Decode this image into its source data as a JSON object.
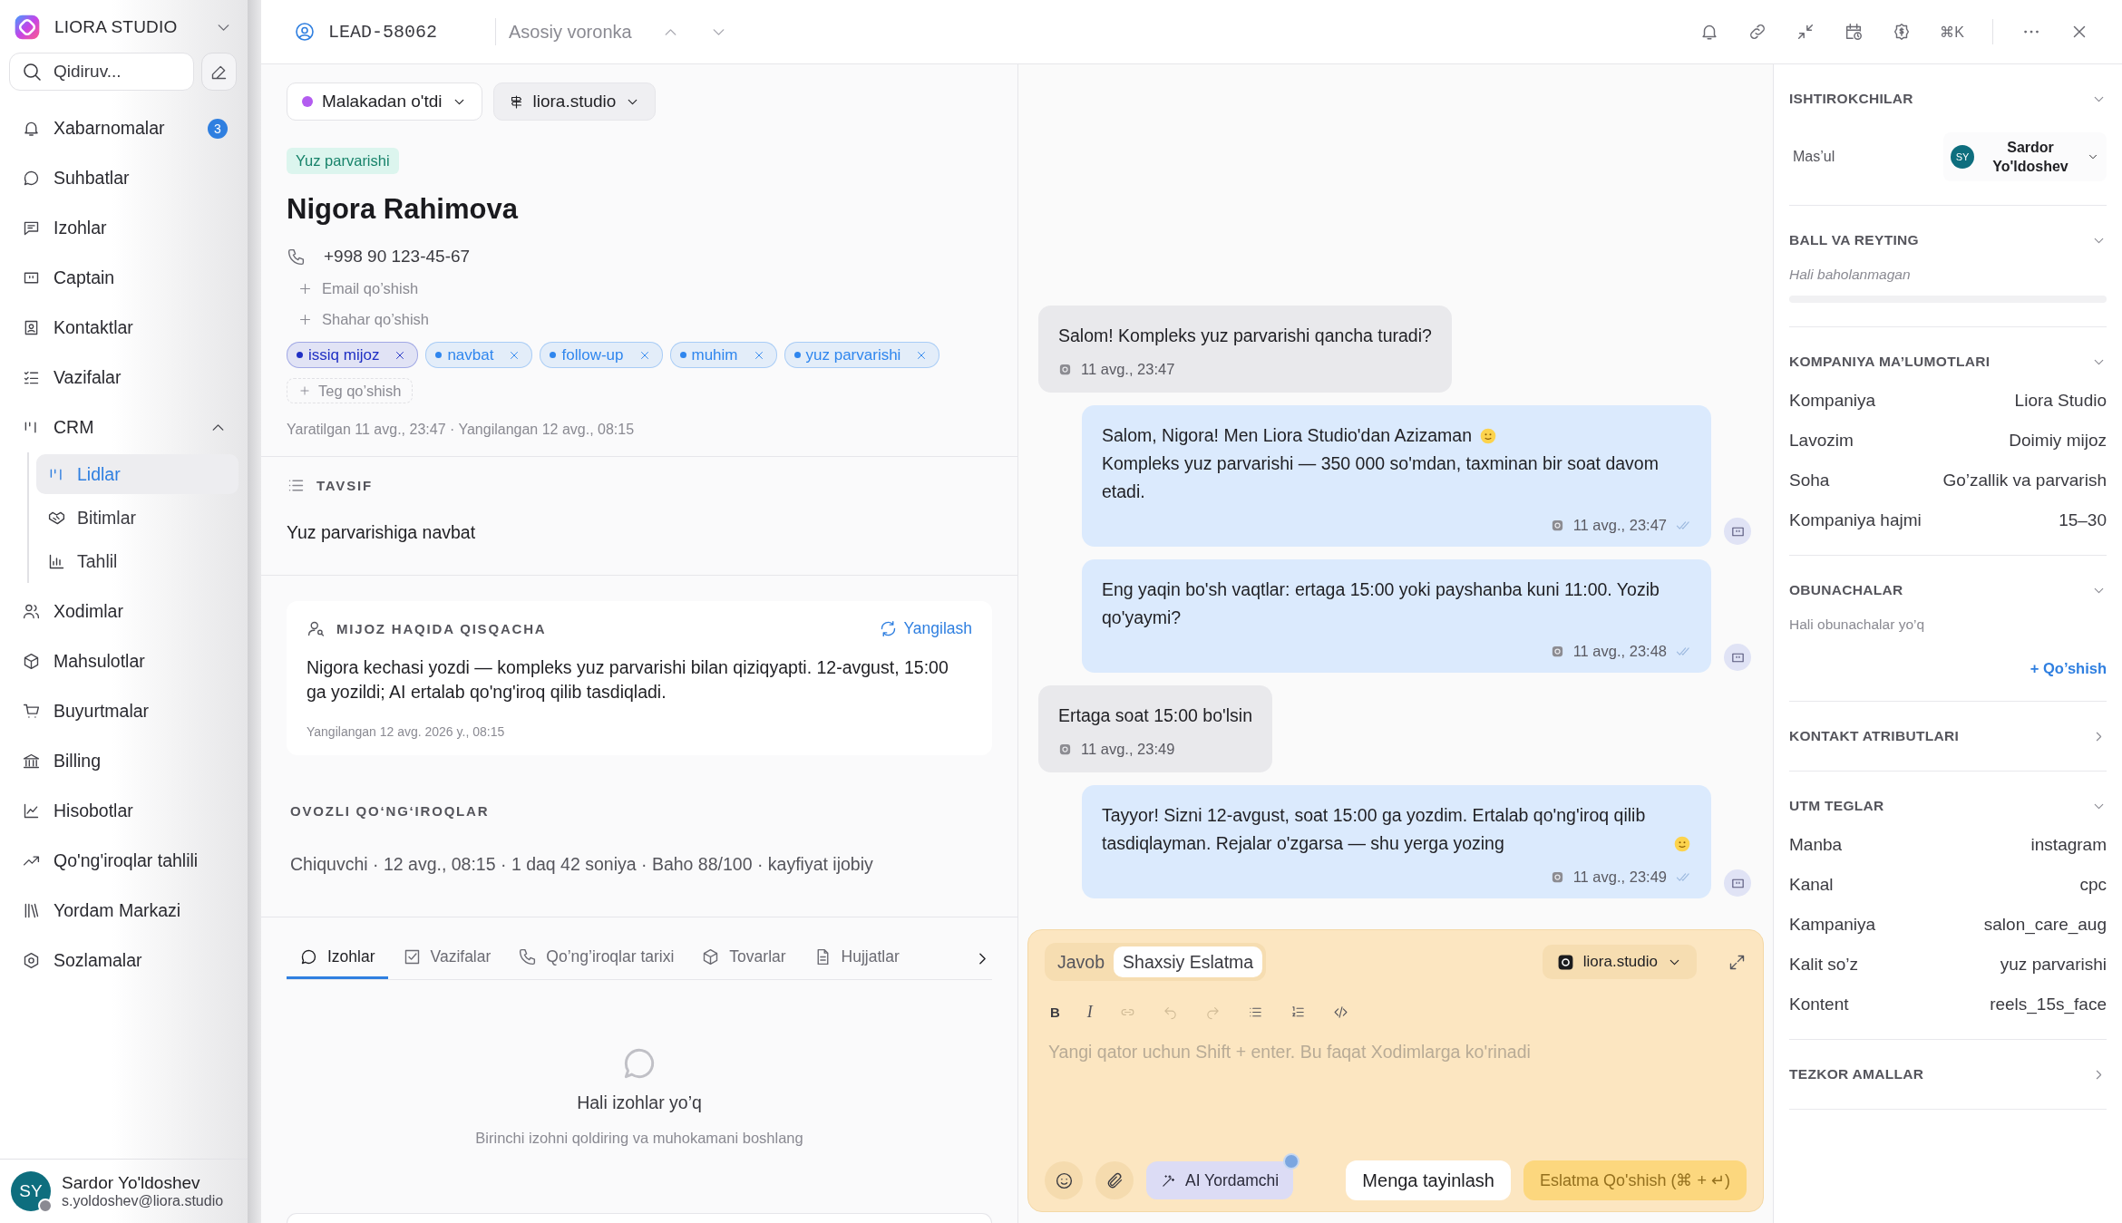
{
  "sidebar": {
    "workspace": "LIORA STUDIO",
    "search_placeholder": "Qidiruv...",
    "items": [
      {
        "label": "Xabarnomalar",
        "badge": "3",
        "selected": false
      },
      {
        "label": "Suhbatlar",
        "selected": false
      },
      {
        "label": "Izohlar",
        "selected": false
      },
      {
        "label": "Captain",
        "selected": false
      },
      {
        "label": "Kontaktlar",
        "selected": false
      },
      {
        "label": "Vazifalar",
        "selected": false
      },
      {
        "label": "CRM",
        "selected": false,
        "expanded": true,
        "children": [
          {
            "label": "Lidlar",
            "selected": true
          },
          {
            "label": "Bitimlar",
            "selected": false
          },
          {
            "label": "Tahlil",
            "selected": false
          }
        ]
      },
      {
        "label": "Xodimlar",
        "selected": false
      },
      {
        "label": "Mahsulotlar",
        "selected": false
      },
      {
        "label": "Buyurtmalar",
        "selected": false
      },
      {
        "label": "Billing",
        "selected": false
      },
      {
        "label": "Hisobotlar",
        "selected": false
      },
      {
        "label": "Qo'ng'iroqlar tahlili",
        "selected": false
      },
      {
        "label": "Yordam Markazi",
        "selected": false
      },
      {
        "label": "Sozlamalar",
        "selected": false
      }
    ],
    "user": {
      "initials": "SY",
      "name": "Sardor Yo'ldoshev",
      "email": "s.yoldoshev@liora.studio"
    }
  },
  "header": {
    "lead_id": "LEAD-58062",
    "pipeline": "Asosiy voronka",
    "shortcut": "⌘K"
  },
  "lead": {
    "status": {
      "label": "Malakadan o'tdi",
      "color": "#b35cf0"
    },
    "inbox": "liora.studio",
    "category": "Yuz parvarishi",
    "name": "Nigora Rahimova",
    "phone": "+998 90 123-45-67",
    "add_links": [
      "Email qo’shish",
      "Shahar qo’shish"
    ],
    "tags": [
      {
        "label": "issiq mijoz",
        "color": "#1f2fc4"
      },
      {
        "label": "navbat",
        "color": "#2f86ee"
      },
      {
        "label": "follow-up",
        "color": "#2f86ee"
      },
      {
        "label": "muhim",
        "color": "#2f86ee"
      },
      {
        "label": "yuz parvarishi",
        "color": "#2f86ee"
      }
    ],
    "add_tag": "Teg qo’shish",
    "meta": "Yaratilgan 11 avg., 23:47 · Yangilangan 12 avg., 08:15"
  },
  "description": {
    "title": "TAVSIF",
    "text": "Yuz parvarishiga navbat"
  },
  "summary": {
    "title": "MIJOZ HAQIDA QISQACHA",
    "refresh": "Yangilash",
    "text": "Nigora kechasi yozdi — kompleks yuz parvarishi bilan qiziqyapti. 12-avgust, 15:00 ga yozildi; AI ertalab qo'ng'iroq qilib tasdiqladi.",
    "updated": "Yangilangan 12 avg. 2026 y., 08:15"
  },
  "voice_calls": {
    "title": "OVOZLI QO‘NG‘IROQLAR",
    "entry": "Chiquvchi · 12 avg., 08:15 · 1 daq 42 soniya · Baho 88/100 · kayfiyat ijobiy"
  },
  "tabs": [
    {
      "label": "Izohlar",
      "selected": true
    },
    {
      "label": "Vazifalar",
      "selected": false
    },
    {
      "label": "Qo’ng’iroqlar tarixi",
      "selected": false
    },
    {
      "label": "Tovarlar",
      "selected": false
    },
    {
      "label": "Hujjatlar",
      "selected": false
    }
  ],
  "empty_state": {
    "title": "Hali izohlar yo’q",
    "text": "Birinchi izohni qoldiring va muhokamani boshlang"
  },
  "messages": [
    {
      "kind": "incoming",
      "parts": [
        "Salom! Kompleks yuz parvarishi qancha turadi?"
      ],
      "time": "11 avg., 23:47"
    },
    {
      "kind": "outgoing",
      "parts": [
        "Salom, Nigora! Men Liora Studio'dan Azizaman",
        "Kompleks yuz parvarishi — 350 000 so'mdan, taxminan bir soat davom etadi."
      ],
      "time": "11 avg., 23:47"
    },
    {
      "kind": "outgoing",
      "parts": [
        "Eng yaqin bo'sh vaqtlar: ertaga 15:00 yoki payshanba kuni 11:00. Yozib qo'yaymi?"
      ],
      "time": "11 avg., 23:48"
    },
    {
      "kind": "incoming",
      "parts": [
        "Ertaga soat 15:00 bo'lsin"
      ],
      "time": "11 avg., 23:49"
    },
    {
      "kind": "outgoing",
      "parts": [
        "Tayyor! Sizni 12-avgust, soat 15:00 ga yozdim. Ertalab qo'ng'iroq qilib tasdiqlayman. Rejalar o'zgarsa — shu yerga yozing"
      ],
      "trailing_emoji": true,
      "time": "11 avg., 23:49"
    }
  ],
  "composer": {
    "modes": [
      {
        "label": "Javob",
        "selected": false
      },
      {
        "label": "Shaxsiy Eslatma",
        "selected": true
      }
    ],
    "inbox": "liora.studio",
    "bold": "B",
    "italic": "I",
    "placeholder": "Yangi qator uchun Shift + enter. Bu faqat Xodimlarga ko'rinadi",
    "ai_button": "AI Yordamchi",
    "assign_button": "Menga tayinlash",
    "submit_button": {
      "label": "Eslatma Qo'shish (⌘ + ↵)",
      "disabled": true
    }
  },
  "details": [
    {
      "kind": "participants",
      "title": "ISHTIROKCHILAR",
      "expanded": true,
      "role": "Mas’ul",
      "assignee": {
        "initials": "SY",
        "name": "Sardor Yo'ldoshev"
      }
    },
    {
      "kind": "rating",
      "title": "BALL VA REYTING",
      "expanded": true,
      "note": "Hali baholanmagan"
    },
    {
      "kind": "fields",
      "title": "KOMPANIYA MA’LUMOTLARI",
      "expanded": true,
      "rows": [
        {
          "label": "Kompaniya",
          "value": "Liora Studio"
        },
        {
          "label": "Lavozim",
          "value": "Doimiy mijoz"
        },
        {
          "label": "Soha",
          "value": "Go’zallik va parvarish"
        },
        {
          "label": "Kompaniya hajmi",
          "value": "15–30"
        }
      ]
    },
    {
      "kind": "followers",
      "title": "OBUNACHALAR",
      "expanded": true,
      "note": "Hali obunachalar yo’q",
      "action": "+ Qo’shish"
    },
    {
      "kind": "plain",
      "title": "KONTAKT ATRIBUTLARI",
      "expanded": false
    },
    {
      "kind": "fields",
      "title": "UTM TEGLAR",
      "expanded": true,
      "rows": [
        {
          "label": "Manba",
          "value": "instagram"
        },
        {
          "label": "Kanal",
          "value": "cpc"
        },
        {
          "label": "Kampaniya",
          "value": "salon_care_aug"
        },
        {
          "label": "Kalit so’z",
          "value": "yuz parvarishi"
        },
        {
          "label": "Kontent",
          "value": "reels_15s_face"
        }
      ]
    },
    {
      "kind": "plain",
      "title": "TEZKOR AMALLAR",
      "expanded": false
    }
  ]
}
